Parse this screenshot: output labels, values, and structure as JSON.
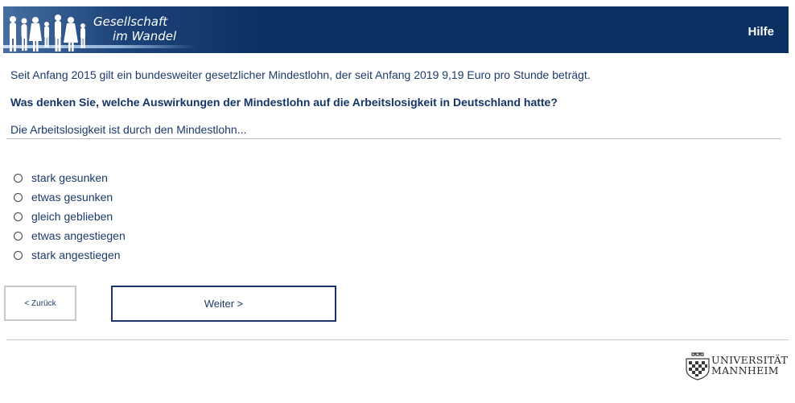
{
  "header": {
    "brand_line1": "Gesellschaft",
    "brand_line2": "im Wandel",
    "help_label": "Hilfe",
    "background_color": "#0b3163"
  },
  "intro_text": "Seit Anfang 2015 gilt ein bundesweiter gesetzlicher Mindestlohn, der seit Anfang 2019 9,19 Euro pro Stunde beträgt.",
  "question_text": "Was denken Sie, welche Auswirkungen der Mindestlohn auf die Arbeitslosigkeit in Deutschland hatte?",
  "stem_text": "Die Arbeitslosigkeit ist durch den Mindestlohn...",
  "options": [
    {
      "label": "stark gesunken",
      "selected": false
    },
    {
      "label": "etwas gesunken",
      "selected": false
    },
    {
      "label": "gleich geblieben",
      "selected": false
    },
    {
      "label": "etwas angestiegen",
      "selected": false
    },
    {
      "label": "stark angestiegen",
      "selected": false
    }
  ],
  "navigation": {
    "back_label": "< Zurück",
    "next_label": "Weiter >"
  },
  "footer": {
    "logo_line1": "UNIVERSITÄT",
    "logo_line2": "MANNHEIM",
    "logo_icon": "university-crest-icon"
  }
}
